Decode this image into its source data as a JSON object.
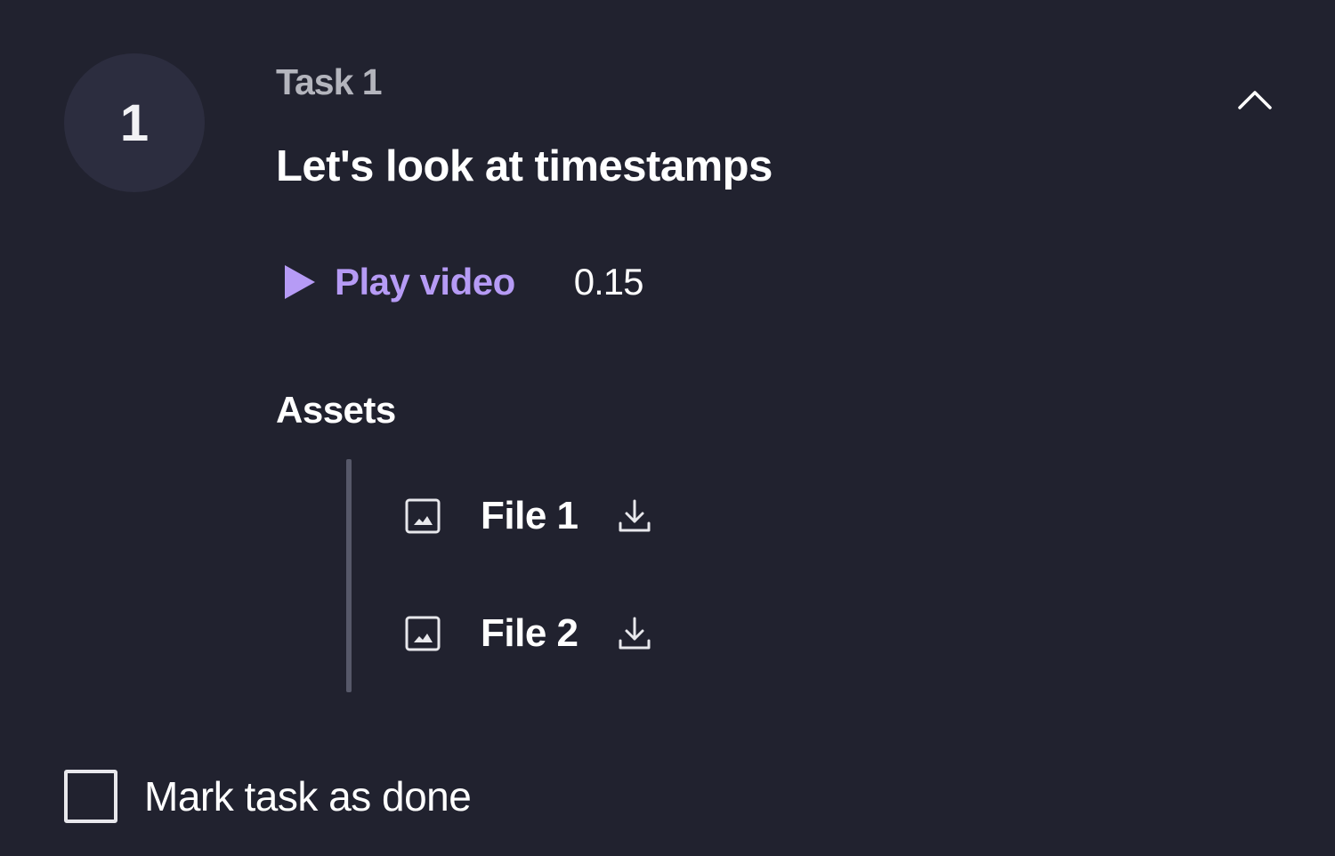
{
  "task": {
    "number": "1",
    "label": "Task 1",
    "title": "Let's look at timestamps",
    "collapse_icon": "chevron-up-icon"
  },
  "video": {
    "play_label": "Play video",
    "timestamp": "0.15",
    "icon": "play-icon",
    "accent_color": "#b69bf5"
  },
  "assets": {
    "heading": "Assets",
    "files": [
      {
        "name": "File 1",
        "type_icon": "image-icon",
        "action_icon": "download-icon"
      },
      {
        "name": "File 2",
        "type_icon": "image-icon",
        "action_icon": "download-icon"
      }
    ]
  },
  "completion": {
    "label": "Mark task as done",
    "checked": false
  },
  "colors": {
    "background": "#21222f",
    "circle": "#2c2d3f",
    "rail": "#565869",
    "muted_text": "#b4b5bd"
  }
}
